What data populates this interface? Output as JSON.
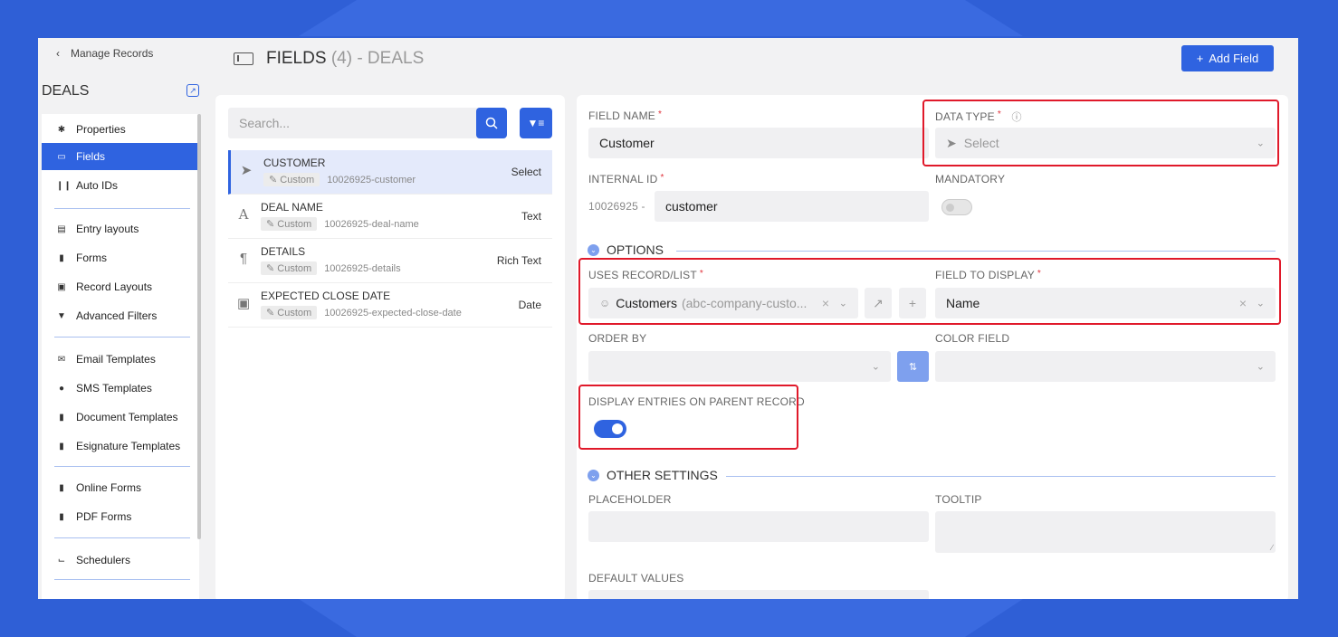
{
  "sidebar": {
    "back_label": "Manage Records",
    "title": "DEALS",
    "items": [
      {
        "label": "Properties",
        "icon": "gear-icon"
      },
      {
        "label": "Fields",
        "icon": "field-icon"
      },
      {
        "label": "Auto IDs",
        "icon": "barcode-icon"
      },
      {
        "label": "Entry layouts",
        "icon": "layout-icon"
      },
      {
        "label": "Forms",
        "icon": "document-icon"
      },
      {
        "label": "Record Layouts",
        "icon": "record-layout-icon"
      },
      {
        "label": "Advanced Filters",
        "icon": "filter-icon"
      },
      {
        "label": "Email Templates",
        "icon": "email-icon"
      },
      {
        "label": "SMS Templates",
        "icon": "sms-icon"
      },
      {
        "label": "Document Templates",
        "icon": "document-template-icon"
      },
      {
        "label": "Esignature Templates",
        "icon": "esignature-icon"
      },
      {
        "label": "Online Forms",
        "icon": "online-form-icon"
      },
      {
        "label": "PDF Forms",
        "icon": "pdf-icon"
      },
      {
        "label": "Schedulers",
        "icon": "scheduler-icon"
      }
    ]
  },
  "header": {
    "title": "FIELDS",
    "count": "(4)",
    "suffix": "- DEALS",
    "add_label": "Add Field"
  },
  "field_list": {
    "search_placeholder": "Search...",
    "fields": [
      {
        "name": "CUSTOMER",
        "badge": "Custom",
        "id": "10026925-customer",
        "type": "Select",
        "icon": "cursor-icon"
      },
      {
        "name": "DEAL NAME",
        "badge": "Custom",
        "id": "10026925-deal-name",
        "type": "Text",
        "icon": "text-icon"
      },
      {
        "name": "DETAILS",
        "badge": "Custom",
        "id": "10026925-details",
        "type": "Rich Text",
        "icon": "paragraph-icon"
      },
      {
        "name": "EXPECTED CLOSE DATE",
        "badge": "Custom",
        "id": "10026925-expected-close-date",
        "type": "Date",
        "icon": "calendar-icon"
      }
    ]
  },
  "detail": {
    "field_name_label": "FIELD NAME",
    "field_name_value": "Customer",
    "data_type_label": "DATA TYPE",
    "data_type_value": "Select",
    "internal_id_label": "INTERNAL ID",
    "internal_id_prefix": "10026925 -",
    "internal_id_value": "customer",
    "mandatory_label": "MANDATORY",
    "options_heading": "OPTIONS",
    "uses_record_label": "USES RECORD/LIST",
    "uses_record_value": "Customers",
    "uses_record_sub": "(abc-company-custo...",
    "field_to_display_label": "FIELD TO DISPLAY",
    "field_to_display_value": "Name",
    "order_by_label": "ORDER BY",
    "color_field_label": "COLOR FIELD",
    "display_entries_label": "DISPLAY ENTRIES ON PARENT RECORD",
    "other_settings_heading": "OTHER SETTINGS",
    "placeholder_label": "PLACEHOLDER",
    "tooltip_label": "TOOLTIP",
    "default_values_label": "DEFAULT VALUES"
  }
}
